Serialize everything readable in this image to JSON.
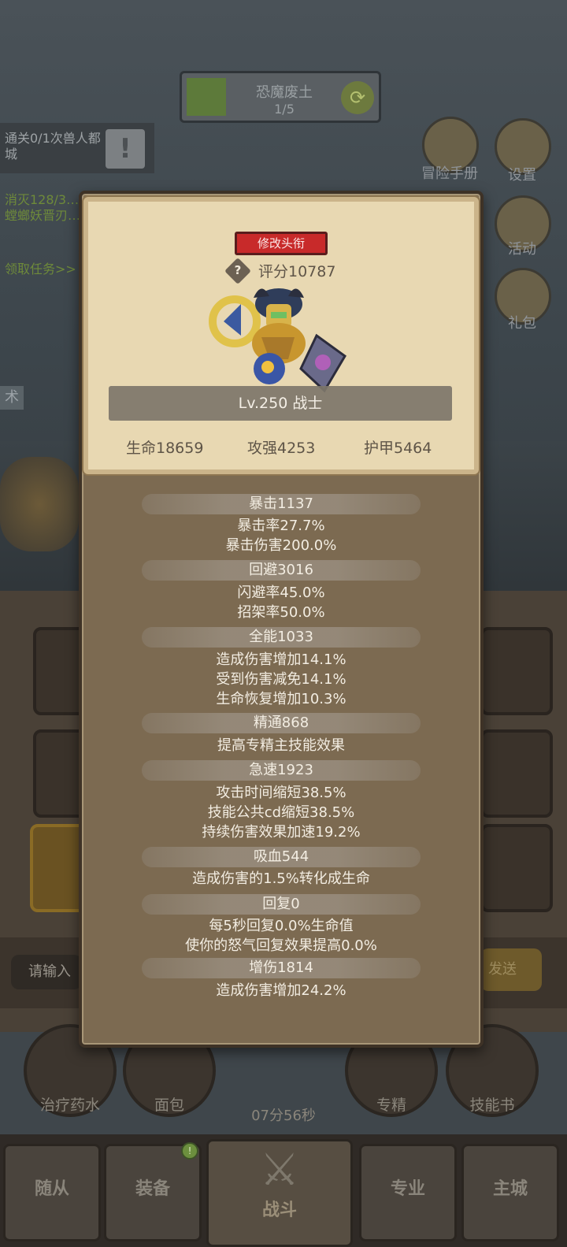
{
  "stage": {
    "name": "恐魔废土",
    "progress": "1/5"
  },
  "quest": {
    "line1": "通关0/1次兽人都城",
    "line2": "消灭128/3… 螳螂妖晋刃…",
    "claim": "领取任务>>"
  },
  "side_menu": [
    {
      "label": "冒险手册",
      "icon": "book-icon"
    },
    {
      "label": "设置",
      "icon": "gear-icon"
    },
    {
      "label": "活动",
      "icon": "scroll-icon"
    },
    {
      "label": "礼包",
      "icon": "gift-icon"
    }
  ],
  "skill_tag": "术",
  "chat": {
    "placeholder": "请输入",
    "send_label": "发送"
  },
  "items": [
    {
      "label": "治疗药水",
      "icon": "potion-icon"
    },
    {
      "label": "面包",
      "icon": "bread-icon"
    },
    {
      "label": "专精",
      "icon": "mastery-icon"
    },
    {
      "label": "技能书",
      "icon": "skill-book-icon"
    }
  ],
  "timer": "07分56秒",
  "tabs": {
    "followers": "随从",
    "equipment": "装备",
    "battle": "战斗",
    "profession": "专业",
    "main_city": "主城"
  },
  "profile": {
    "title_button": "修改头衔",
    "score": "评分10787",
    "level": "Lv.250 战士",
    "hp": "生命18659",
    "attack": "攻强4253",
    "armor": "护甲5464"
  },
  "stats": [
    {
      "name": "暴击1137",
      "details": [
        "暴击率27.7%",
        "暴击伤害200.0%"
      ]
    },
    {
      "name": "回避3016",
      "details": [
        "闪避率45.0%",
        "招架率50.0%"
      ]
    },
    {
      "name": "全能1033",
      "details": [
        "造成伤害增加14.1%",
        "受到伤害减免14.1%",
        "生命恢复增加10.3%"
      ]
    },
    {
      "name": "精通868",
      "details": [
        "提高专精主技能效果"
      ]
    },
    {
      "name": "急速1923",
      "details": [
        "攻击时间缩短38.5%",
        "技能公共cd缩短38.5%",
        "持续伤害效果加速19.2%"
      ]
    },
    {
      "name": "吸血544",
      "details": [
        "造成伤害的1.5%转化成生命"
      ]
    },
    {
      "name": "回复0",
      "details": [
        "每5秒回复0.0%生命值",
        "使你的怒气回复效果提高0.0%"
      ]
    },
    {
      "name": "增伤1814",
      "details": [
        "造成伤害增加24.2%"
      ]
    }
  ],
  "colors": {
    "panel": "#7c6a51",
    "card": "#e8d8b2",
    "title_button": "#c82a2a"
  }
}
